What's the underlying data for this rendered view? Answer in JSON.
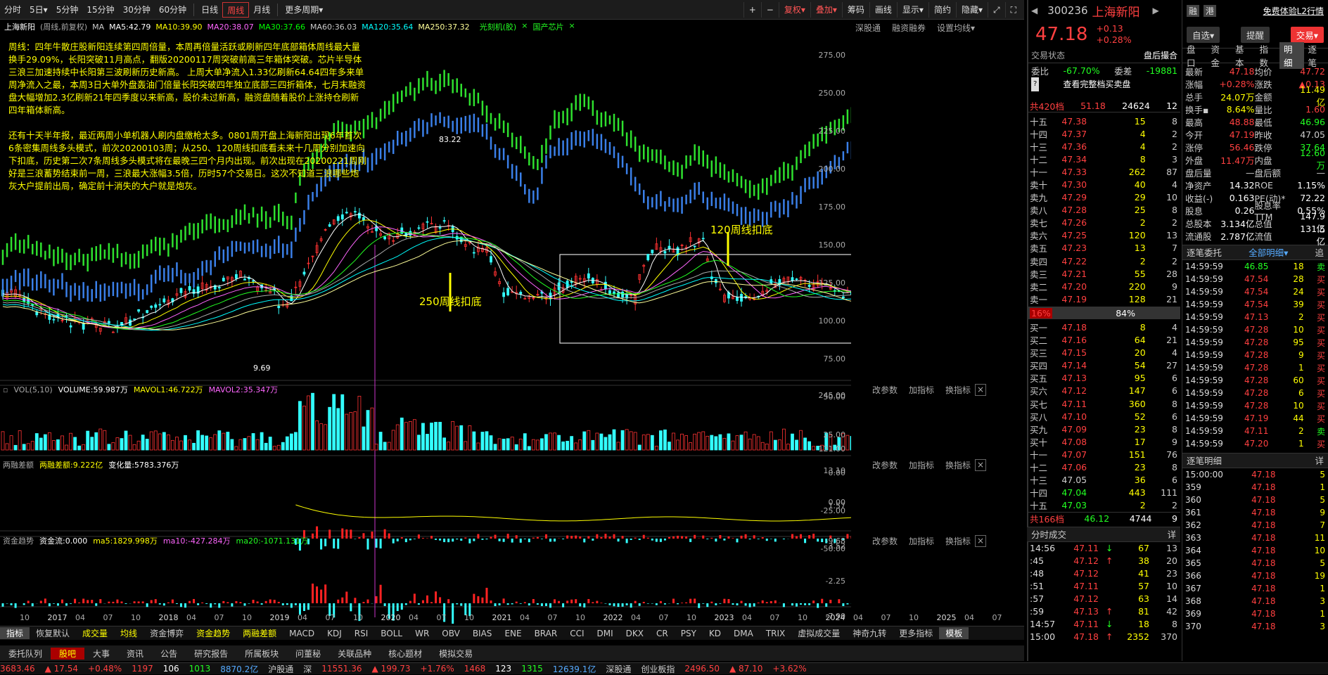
{
  "toolbar": {
    "periods": [
      "分时",
      "5日▾",
      "5分钟",
      "15分钟",
      "30分钟",
      "60分钟",
      "日线",
      "周线",
      "月线",
      "更多周期▾"
    ],
    "active_period": "周线",
    "right_buttons": [
      "复权▾",
      "叠加▾",
      "筹码",
      "画线",
      "显示▾",
      "简约",
      "隐藏▾"
    ]
  },
  "chart_header": {
    "stock": "上海新阳",
    "mode": "(周线,前复权)",
    "ma_items": [
      {
        "text": "MA5:42.79",
        "color": "#ffffff"
      },
      {
        "text": "MA10:39.90",
        "color": "#ffff00"
      },
      {
        "text": "MA20:38.07",
        "color": "#ff66ff"
      },
      {
        "text": "MA30:37.66",
        "color": "#00ff00"
      },
      {
        "text": "MA60:36.03",
        "color": "#cccccc"
      },
      {
        "text": "MA120:35.64",
        "color": "#00ffff"
      },
      {
        "text": "MA250:37.32",
        "color": "#ffff99"
      }
    ],
    "tags": [
      "光刻机(胶)",
      "国产芯片"
    ],
    "right_links": [
      "深股通",
      "融资融券",
      "设置均线▾"
    ],
    "ma_prefix": "MA"
  },
  "annotation": {
    "p1": "周线：四年牛散庄股新阳连续第四周倍量，本周再倍量活跃或刷新四年底部箱体周线最大量换手29.09%，长阳突破11月高点，翻版20200117周突破前高三年箱体突破。芯片半导体三浪三加速持续中长阳第三波刷新历史新高。 上周大单净流入1.33亿刷新64.64四年多来单周净流入之最，本周3日大单外盘轰油门倍量长阳突破四年独立底部三四折箱体，七月末融资盘大幅增加2.3亿刷新21年四季度以来新高，股价未过新高，融资盘随着股价上涨持仓刷新四年箱体新高。",
    "p2": "还有十天半年报，最近两周小单机器人刷内盘缴枪太多。0801周开盘上海新阳出现6年首次6条密集周线多头模式，前次20200103周；从250、120周线扣底看未来十几周分别加速向下扣底，历史第二次7条周线多头模式将在最晚三四个月内出现。前次出现在20200221周刚好是三浪蓄势结束前一周，三浪最大涨幅3.5倍，历时57个交易日。这次不知道三浪哪些炮灰大户提前出局，确定前十消失的大户就是炮灰。"
  },
  "chart_labels": {
    "high": "83.22",
    "low": "9.69",
    "label_250": "250周线扣底",
    "label_120": "120周线扣底"
  },
  "main_axis": [
    "275.00",
    "250.00",
    "225.00",
    "200.00",
    "175.00",
    "150.00",
    "125.00",
    "100.00",
    "75.00",
    "50.00",
    "25.00",
    "0.00",
    "-25.00",
    "-50.00"
  ],
  "vol_pane": {
    "title": "VOL(5,10)",
    "v1": "VOLUME:59.987万",
    "v2": "MAVOL1:46.722万",
    "v3": "MAVOL2:35.347万",
    "axis": [
      "245.00",
      "121.00",
      "0.00"
    ]
  },
  "margin_pane": {
    "title": "两融差额",
    "v1": "两融差额:9.222亿",
    "v2": "变化量:5783.376万",
    "axis": [
      "13.10",
      "1.57",
      "-9.68"
    ]
  },
  "fund_pane": {
    "title": "资金趋势",
    "v1": "资金流:0.000",
    "v2": "ma5:1829.998万",
    "v3": "ma10:-427.284万",
    "v4": "ma20:-1071.131万",
    "axis": [
      "3.52",
      "-2.25",
      "-7.90"
    ]
  },
  "pane_links": [
    "改参数",
    "加指标",
    "换指标"
  ],
  "x_labels": [
    "10",
    "2017",
    "04",
    "07",
    "10",
    "2018",
    "04",
    "07",
    "10",
    "2019",
    "04",
    "07",
    "10",
    "2020",
    "04",
    "07",
    "10",
    "2021",
    "04",
    "07",
    "10",
    "2022",
    "04",
    "07",
    "10",
    "2023",
    "04",
    "07",
    "10",
    "2024",
    "04",
    "07",
    "10",
    "2025",
    "04",
    "07"
  ],
  "indicator_tabs": [
    "指标",
    "恢复默认",
    "成交量",
    "均线",
    "资金博弈",
    "资金趋势",
    "两融差额",
    "MACD",
    "KDJ",
    "RSI",
    "BOLL",
    "WR",
    "OBV",
    "BIAS",
    "ENE",
    "BRAR",
    "CCI",
    "DMI",
    "DKX",
    "CR",
    "PSY",
    "KD",
    "DMA",
    "TRIX",
    "虚拟成交量",
    "神奇九转",
    "更多指标",
    "模板"
  ],
  "bottom_tabs": [
    "委托队列",
    "股吧",
    "大事",
    "资讯",
    "公告",
    "研究报告",
    "所属板块",
    "问董秘",
    "关联品种",
    "核心题材",
    "模拟交易"
  ],
  "status": [
    {
      "t": "3683.46",
      "c": "#ff4040"
    },
    {
      "t": "▲ 17.54",
      "c": "#ff4040"
    },
    {
      "t": "+0.48%",
      "c": "#ff4040"
    },
    {
      "t": "1197",
      "c": "#ff4040"
    },
    {
      "t": "106",
      "c": "#fff"
    },
    {
      "t": "1013",
      "c": "#2f2"
    },
    {
      "t": "8870.2亿",
      "c": "#5af"
    },
    {
      "t": "沪股通",
      "c": "#ccc"
    },
    {
      "t": "深",
      "c": "#ccc"
    },
    {
      "t": "11551.36",
      "c": "#ff4040"
    },
    {
      "t": "▲ 199.73",
      "c": "#ff4040"
    },
    {
      "t": "+1.76%",
      "c": "#ff4040"
    },
    {
      "t": "1468",
      "c": "#ff4040"
    },
    {
      "t": "123",
      "c": "#fff"
    },
    {
      "t": "1315",
      "c": "#2f2"
    },
    {
      "t": "12639.1亿",
      "c": "#5af"
    },
    {
      "t": "深股通",
      "c": "#ccc"
    },
    {
      "t": "创业板指",
      "c": "#ccc"
    },
    {
      "t": "2496.50",
      "c": "#ff4040"
    },
    {
      "t": "▲ 87.10",
      "c": "#ff4040"
    },
    {
      "t": "+3.62%",
      "c": "#ff4040"
    }
  ],
  "quote": {
    "code": "300236",
    "name": "上海新阳",
    "price": "47.18",
    "chg": "+0.13",
    "pct": "+0.28%",
    "badges": [
      "融",
      "港"
    ],
    "l2": "免费体验L2行情",
    "btns": [
      "自选▾",
      "提醒",
      "交易▾"
    ],
    "state_label": "交易状态",
    "state": "盘后撮合",
    "wb_label": "委比",
    "wb": "-67.70%",
    "wc_label": "委差",
    "wc": "-19881",
    "full_label": "查看完整档买卖盘",
    "sell_total": {
      "l": "共420档",
      "p": "51.18",
      "v": "24624",
      "n": "12"
    },
    "buy_total": {
      "l": "共166档",
      "p": "46.12",
      "v": "4744",
      "n": "9"
    },
    "mid": {
      "l": "16%",
      "r": "84%"
    },
    "sells": [
      [
        "十五",
        "47.38",
        "15",
        "8"
      ],
      [
        "十四",
        "47.37",
        "4",
        "2"
      ],
      [
        "十三",
        "47.36",
        "4",
        "2"
      ],
      [
        "十二",
        "47.34",
        "8",
        "3"
      ],
      [
        "十一",
        "47.33",
        "262",
        "87"
      ],
      [
        "卖十",
        "47.30",
        "40",
        "4"
      ],
      [
        "卖九",
        "47.29",
        "29",
        "10"
      ],
      [
        "卖八",
        "47.28",
        "25",
        "8"
      ],
      [
        "卖七",
        "47.26",
        "2",
        "2"
      ],
      [
        "卖六",
        "47.25",
        "120",
        "13"
      ],
      [
        "卖五",
        "47.23",
        "13",
        "7"
      ],
      [
        "卖四",
        "47.22",
        "2",
        "2"
      ],
      [
        "卖三",
        "47.21",
        "55",
        "28"
      ],
      [
        "卖二",
        "47.20",
        "220",
        "9"
      ],
      [
        "卖一",
        "47.19",
        "128",
        "21"
      ]
    ],
    "buys": [
      [
        "买一",
        "47.18",
        "8",
        "4"
      ],
      [
        "买二",
        "47.16",
        "64",
        "21"
      ],
      [
        "买三",
        "47.15",
        "20",
        "4"
      ],
      [
        "买四",
        "47.14",
        "54",
        "27"
      ],
      [
        "买五",
        "47.13",
        "95",
        "6"
      ],
      [
        "买六",
        "47.12",
        "147",
        "6"
      ],
      [
        "买七",
        "47.11",
        "360",
        "8"
      ],
      [
        "买八",
        "47.10",
        "52",
        "6"
      ],
      [
        "买九",
        "47.09",
        "23",
        "8"
      ],
      [
        "买十",
        "47.08",
        "17",
        "9"
      ],
      [
        "十一",
        "47.07",
        "151",
        "76"
      ],
      [
        "十二",
        "47.06",
        "23",
        "8"
      ],
      [
        "十三",
        "47.05",
        "36",
        "6"
      ],
      [
        "十四",
        "47.04",
        "443",
        "111"
      ],
      [
        "十五",
        "47.03",
        "2",
        "2"
      ]
    ],
    "ticks_label": "分时成交",
    "ticks_more": "详",
    "ticks": [
      [
        "14:56",
        "47.11",
        "↓",
        "67",
        "13"
      ],
      [
        ":45",
        "47.12",
        "↑",
        "38",
        "20"
      ],
      [
        ":48",
        "47.12",
        "",
        "41",
        "23"
      ],
      [
        ":51",
        "47.11",
        "",
        "57",
        "10"
      ],
      [
        ":57",
        "47.12",
        "",
        "63",
        "14"
      ],
      [
        ":59",
        "47.13",
        "↑",
        "81",
        "42"
      ],
      [
        "14:57",
        "47.11",
        "↓",
        "18",
        "8"
      ],
      [
        "15:00",
        "47.18",
        "↑",
        "2352",
        "370"
      ]
    ]
  },
  "stats": {
    "tabs": [
      "盘口",
      "资金",
      "基本",
      "指数",
      "明细",
      "逐笔"
    ],
    "active_tab": "明细",
    "rows": [
      [
        "最新",
        "47.18",
        "均价",
        "47.72"
      ],
      [
        "涨幅",
        "+0.28%",
        "涨跌",
        "▲0.13"
      ],
      [
        "总手",
        "24.07万",
        "金额",
        "11.49亿"
      ],
      [
        "换手▪",
        "8.64%",
        "量比",
        "1.60"
      ],
      [
        "最高",
        "48.88",
        "最低",
        "46.96"
      ],
      [
        "今开",
        "47.19",
        "昨收",
        "47.05"
      ],
      [
        "涨停",
        "56.46",
        "跌停",
        "37.64"
      ],
      [
        "外盘",
        "11.47万",
        "内盘",
        "12.60万"
      ],
      [
        "盘后量",
        "—",
        "盘后额",
        "—"
      ],
      [
        "净资产",
        "14.32",
        "ROE",
        "1.15%"
      ],
      [
        "收益(-)",
        "0.163",
        "PE(动)*",
        "72.22"
      ],
      [
        "股息",
        "0.26",
        "股息率TTM",
        "0.55%"
      ],
      [
        "总股本",
        "3.134亿",
        "总值",
        "147.9亿"
      ],
      [
        "流通股",
        "2.787亿",
        "流值",
        "131.5亿"
      ]
    ],
    "row_colors": [
      [
        "#ff4040",
        "#ff4040"
      ],
      [
        "#ff4040",
        "#ff4040"
      ],
      [
        "#ff0",
        "#ff0"
      ],
      [
        "#ff0",
        "#ff4040"
      ],
      [
        "#ff4040",
        "#2f2"
      ],
      [
        "#ff4040",
        "#ccc"
      ],
      [
        "#ff4040",
        "#2f2"
      ],
      [
        "#ff4040",
        "#2f2"
      ],
      [
        "#ccc",
        "#ccc"
      ],
      [
        "#fff",
        "#fff"
      ],
      [
        "#fff",
        "#fff"
      ],
      [
        "#fff",
        "#fff"
      ],
      [
        "#fff",
        "#fff"
      ],
      [
        "#fff",
        "#fff"
      ]
    ],
    "order_label": "逐笔委托",
    "order_filter": "全部明细▾",
    "order_btn": "追",
    "orders": [
      [
        "14:59:59",
        "46.85",
        "18",
        "卖"
      ],
      [
        "14:59:59",
        "47.54",
        "28",
        "买"
      ],
      [
        "14:59:59",
        "47.54",
        "24",
        "买"
      ],
      [
        "14:59:59",
        "47.54",
        "39",
        "买"
      ],
      [
        "14:59:59",
        "47.13",
        "2",
        "买"
      ],
      [
        "14:59:59",
        "47.28",
        "10",
        "买"
      ],
      [
        "14:59:59",
        "47.28",
        "95",
        "买"
      ],
      [
        "14:59:59",
        "47.28",
        "9",
        "买"
      ],
      [
        "14:59:59",
        "47.28",
        "1",
        "买"
      ],
      [
        "14:59:59",
        "47.28",
        "60",
        "买"
      ],
      [
        "14:59:59",
        "47.28",
        "6",
        "买"
      ],
      [
        "14:59:59",
        "47.28",
        "10",
        "买"
      ],
      [
        "14:59:59",
        "47.19",
        "44",
        "买"
      ],
      [
        "14:59:59",
        "47.11",
        "2",
        "卖"
      ],
      [
        "14:59:59",
        "47.20",
        "1",
        "买"
      ]
    ],
    "deal_label": "逐笔明细",
    "deal_more": "详",
    "deals": [
      [
        "15:00:00",
        "47.18",
        "5"
      ],
      [
        "359",
        "47.18",
        "1"
      ],
      [
        "360",
        "47.18",
        "5"
      ],
      [
        "361",
        "47.18",
        "9"
      ],
      [
        "362",
        "47.18",
        "7"
      ],
      [
        "363",
        "47.18",
        "11"
      ],
      [
        "364",
        "47.18",
        "10"
      ],
      [
        "365",
        "47.18",
        "5"
      ],
      [
        "366",
        "47.18",
        "19"
      ],
      [
        "367",
        "47.18",
        "1"
      ],
      [
        "368",
        "47.18",
        "3"
      ],
      [
        "369",
        "47.18",
        "1"
      ],
      [
        "370",
        "47.18",
        "3"
      ]
    ]
  }
}
